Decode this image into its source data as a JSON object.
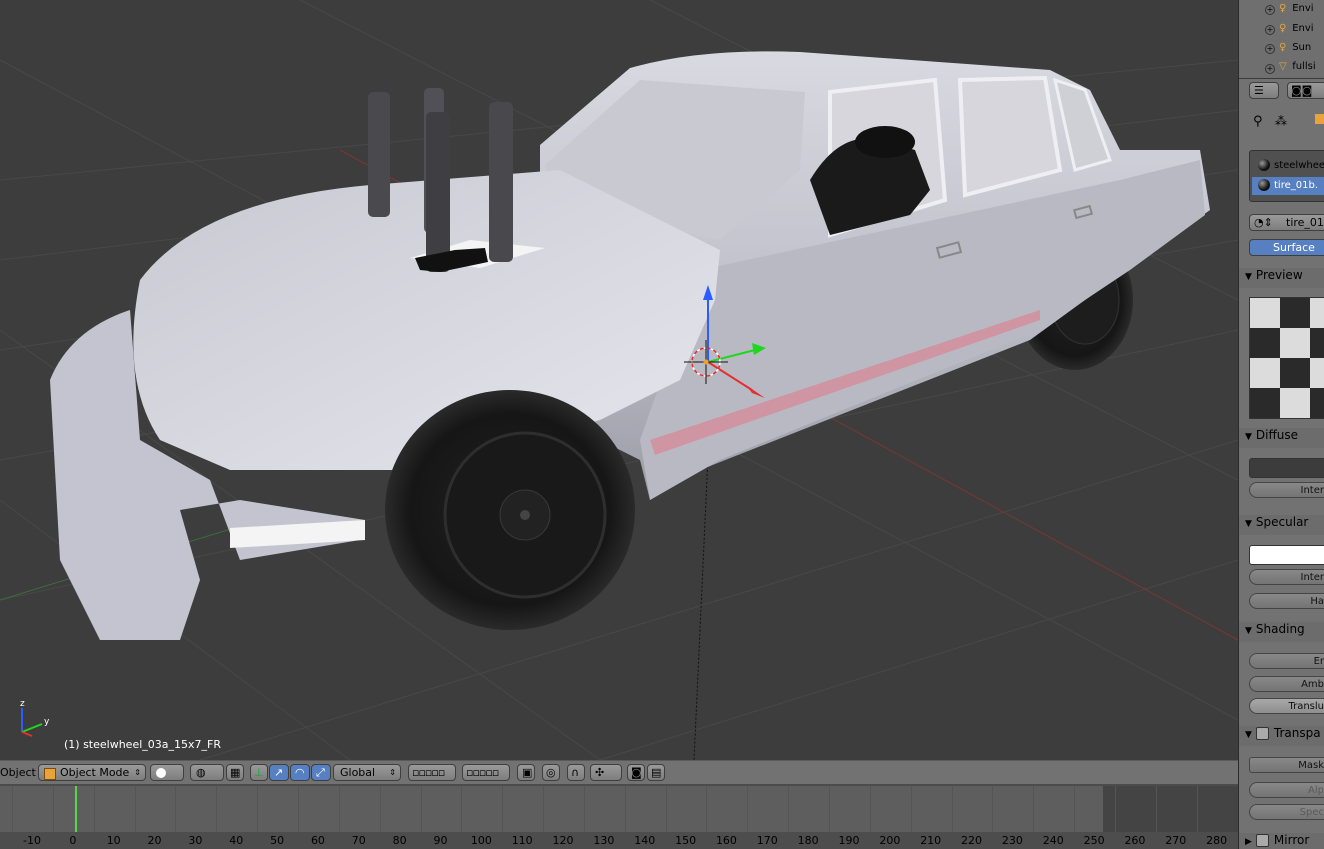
{
  "viewport": {
    "object_label": "(1) steelwheel_03a_15x7_FR",
    "axis_labels": {
      "z": "z",
      "y": "y"
    }
  },
  "header": {
    "menu_partial": "Object",
    "mode": "Object Mode",
    "orientation": "Global"
  },
  "timeline": {
    "ticks": [
      "-10",
      "0",
      "10",
      "20",
      "30",
      "40",
      "50",
      "60",
      "70",
      "80",
      "90",
      "100",
      "110",
      "120",
      "130",
      "140",
      "150",
      "160",
      "170",
      "180",
      "190",
      "200",
      "210",
      "220",
      "230",
      "240",
      "250",
      "260",
      "270",
      "280"
    ],
    "current_frame": 1
  },
  "outliner": {
    "rows": [
      {
        "label": "Envi",
        "icon": "lamp-icon"
      },
      {
        "label": "Envi",
        "icon": "lamp-icon"
      },
      {
        "label": "Sun",
        "icon": "lamp-icon"
      },
      {
        "label": "fullsi",
        "icon": "camera-cone-icon"
      }
    ]
  },
  "material": {
    "slots": [
      "steelwhee",
      "tire_01b."
    ],
    "selected_slot": 1,
    "name_field": "tire_01",
    "surface_tab": "Surface",
    "sections": {
      "preview": "Preview",
      "diffuse": "Diffuse",
      "specular": "Specular",
      "shading": "Shading",
      "transparency": "Transpa",
      "mirror": "Mirror"
    },
    "fields": {
      "diffuse_intensity": "Inter",
      "specular_intensity": "Inter",
      "hardness": "Ha",
      "emit": "Er",
      "ambient": "Amb",
      "translucency": "Translu",
      "mask": "Mask",
      "alpha": "Alp",
      "spec": "Spec"
    },
    "colors": {
      "diffuse": "#3c3c3c",
      "specular": "#ffffff"
    }
  },
  "colors": {
    "selection_blue": "#5680c2",
    "frame_marker": "#5ad24a",
    "viewport_bg": "#3d3d3d"
  }
}
